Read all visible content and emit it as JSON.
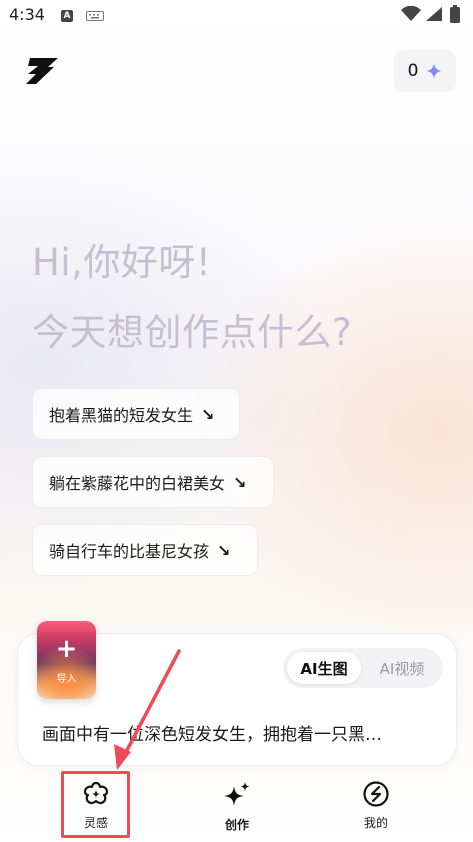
{
  "status_bar": {
    "time": "4:34",
    "notif_letter": "A"
  },
  "header": {
    "credits": "0"
  },
  "greeting": {
    "line1": "Hi,你好呀!",
    "line2": "今天想创作点什么?"
  },
  "suggestions": [
    {
      "label": "抱着黑猫的短发女生",
      "arrow": "↘"
    },
    {
      "label": "躺在紫藤花中的白裙美女",
      "arrow": "↘"
    },
    {
      "label": "骑自行车的比基尼女孩",
      "arrow": "↘"
    }
  ],
  "composer": {
    "import_label": "导入",
    "import_plus": "+",
    "modes": [
      "AI生图",
      "AI视频"
    ],
    "active_mode": "AI生图",
    "prompt": "画面中有一位深色短发女生，拥抱着一只黑…"
  },
  "bottom_nav": [
    {
      "label": "灵感",
      "icon": "inspiration-icon"
    },
    {
      "label": "创作",
      "icon": "sparkle-icon"
    },
    {
      "label": "我的",
      "icon": "profile-icon"
    }
  ],
  "colors": {
    "accent_sparkle": "#8b6cf6",
    "annotation": "#ef4a57",
    "greeting": "#c4c0d2"
  }
}
